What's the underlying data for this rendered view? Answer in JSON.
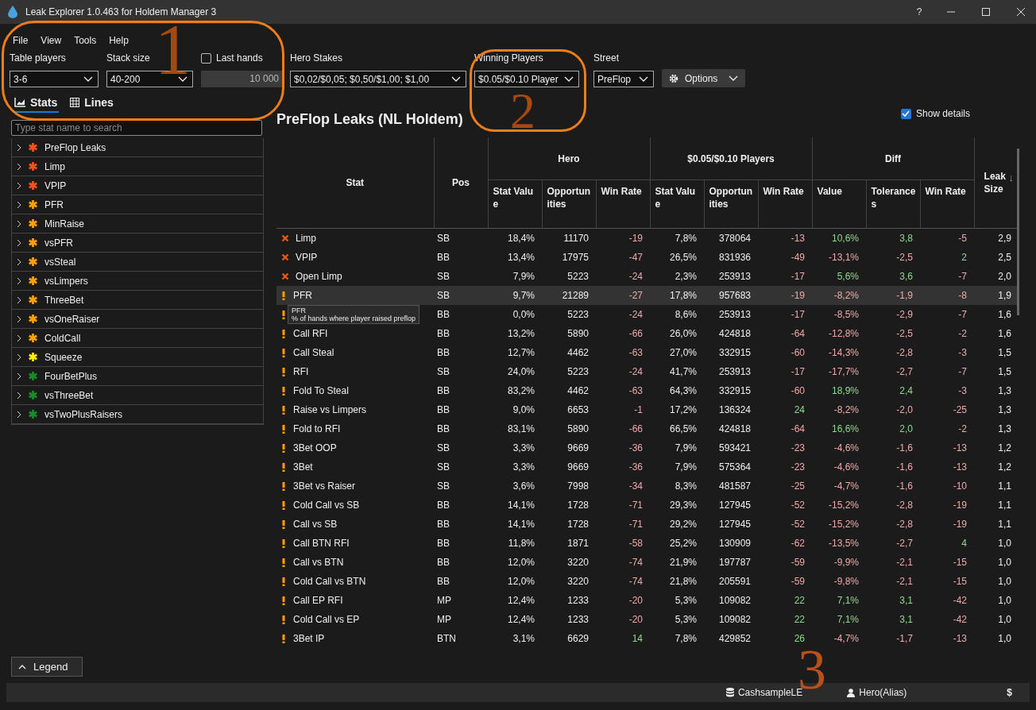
{
  "window": {
    "title": "Leak Explorer 1.0.463 for Holdem Manager 3",
    "help": "?"
  },
  "menu": [
    "File",
    "View",
    "Tools",
    "Help"
  ],
  "filters": [
    {
      "kind": "dropdown",
      "label": "Table players",
      "value": "3-6"
    },
    {
      "kind": "dropdown",
      "label": "Stack size",
      "value": "40-200"
    },
    {
      "kind": "number",
      "label": "Last hands",
      "checked": false,
      "value": "10 000"
    },
    {
      "kind": "dropdown",
      "label": "Hero Stakes",
      "value": "$0,02/$0,05; $0,50/$1,00; $1,00"
    },
    {
      "kind": "dropdown",
      "label": "Winning Players",
      "value": "$0.05/$0.10 Player"
    },
    {
      "kind": "dropdown",
      "label": "Street",
      "value": "PreFlop"
    }
  ],
  "options_button": "Options",
  "tabs": [
    {
      "label": "Stats",
      "selected": true
    },
    {
      "label": "Lines",
      "selected": false
    }
  ],
  "search": {
    "placeholder": "Type stat name to search"
  },
  "tree": [
    {
      "label": "PreFlop Leaks",
      "color": "#f4511e"
    },
    {
      "label": "Limp",
      "color": "#f4511e"
    },
    {
      "label": "VPIP",
      "color": "#f4511e"
    },
    {
      "label": "PFR",
      "color": "#ffa000"
    },
    {
      "label": "MinRaise",
      "color": "#ffa000"
    },
    {
      "label": "vsPFR",
      "color": "#ffa000"
    },
    {
      "label": "vsSteal",
      "color": "#ffa000"
    },
    {
      "label": "vsLimpers",
      "color": "#ffa000"
    },
    {
      "label": "ThreeBet",
      "color": "#ffa000"
    },
    {
      "label": "vsOneRaiser",
      "color": "#ffa000"
    },
    {
      "label": "ColdCall",
      "color": "#ffa000"
    },
    {
      "label": "Squeeze",
      "color": "#ffee00"
    },
    {
      "label": "FourBetPlus",
      "color": "#1b8a2a"
    },
    {
      "label": "vsThreeBet",
      "color": "#1b8a2a"
    },
    {
      "label": "vsTwoPlusRaisers",
      "color": "#1b8a2a"
    }
  ],
  "legend_button": "Legend",
  "report": {
    "title": "PreFlop Leaks  (NL Holdem)",
    "show_details": {
      "label": "Show details",
      "checked": true
    }
  },
  "table": {
    "stat": "Stat",
    "pos": "Pos",
    "groups": [
      {
        "label": "Hero",
        "columns": [
          "Stat Value",
          "Opportunities",
          "Win Rate"
        ]
      },
      {
        "label": "$0.05/$0.10 Players",
        "columns": [
          "Stat Value",
          "Opportunities",
          "Win Rate"
        ]
      },
      {
        "label": "Diff",
        "columns": [
          "Value",
          "Tolerances",
          "Win Rate"
        ]
      }
    ],
    "leak_size": "Leak Size",
    "sort_arrow": "↓",
    "rows": [
      {
        "kind": "error",
        "stat": "Limp",
        "pos": "SB",
        "cells": [
          "18,4%",
          "11170",
          "-19",
          "7,8%",
          "378064",
          "-13",
          "10,6%",
          "3,8",
          "-5"
        ],
        "leak_size": "2,9",
        "selected": false
      },
      {
        "kind": "error",
        "stat": "VPIP",
        "pos": "BB",
        "cells": [
          "13,4%",
          "17975",
          "-47",
          "26,5%",
          "831936",
          "-49",
          "-13,1%",
          "-2,5",
          "2"
        ],
        "leak_size": "2,5",
        "selected": false
      },
      {
        "kind": "error",
        "stat": "Open Limp",
        "pos": "SB",
        "cells": [
          "7,9%",
          "5223",
          "-24",
          "2,3%",
          "253913",
          "-17",
          "5,6%",
          "3,6",
          "-7"
        ],
        "leak_size": "2,0",
        "selected": false
      },
      {
        "kind": "warning",
        "stat": "PFR",
        "pos": "SB",
        "cells": [
          "9,7%",
          "21289",
          "-27",
          "17,8%",
          "957683",
          "-19",
          "-8,2%",
          "-1,9",
          "-8"
        ],
        "leak_size": "1,9",
        "selected": true,
        "tooltip": {
          "title": "PFR",
          "text": "% of hands where player raised preflop"
        }
      },
      {
        "kind": "warning",
        "pos": "BB",
        "cells": [
          "0,0%",
          "5223",
          "-24",
          "8,6%",
          "253913",
          "-17",
          "-8,5%",
          "-2,9",
          "-7"
        ],
        "leak_size": "1,6",
        "selected": false
      },
      {
        "kind": "warning",
        "stat": "Call RFI",
        "pos": "BB",
        "cells": [
          "13,2%",
          "5890",
          "-66",
          "26,0%",
          "424818",
          "-64",
          "-12,8%",
          "-2,5",
          "-2"
        ],
        "leak_size": "1,6",
        "selected": false
      },
      {
        "kind": "warning",
        "stat": "Call Steal",
        "pos": "BB",
        "cells": [
          "12,7%",
          "4462",
          "-63",
          "27,0%",
          "332915",
          "-60",
          "-14,3%",
          "-2,8",
          "-3"
        ],
        "leak_size": "1,5",
        "selected": false
      },
      {
        "kind": "warning",
        "stat": "RFI",
        "pos": "SB",
        "cells": [
          "24,0%",
          "5223",
          "-24",
          "41,7%",
          "253913",
          "-17",
          "-17,7%",
          "-2,7",
          "-7"
        ],
        "leak_size": "1,5",
        "selected": false
      },
      {
        "kind": "warning",
        "stat": "Fold To Steal",
        "pos": "BB",
        "cells": [
          "83,2%",
          "4462",
          "-63",
          "64,3%",
          "332915",
          "-60",
          "18,9%",
          "2,4",
          "-3"
        ],
        "leak_size": "1,3",
        "selected": false
      },
      {
        "kind": "warning",
        "stat": "Raise vs Limpers",
        "pos": "BB",
        "cells": [
          "9,0%",
          "6653",
          "-1",
          "17,2%",
          "136324",
          "24",
          "-8,2%",
          "-2,0",
          "-25"
        ],
        "leak_size": "1,3",
        "selected": false
      },
      {
        "kind": "warning",
        "stat": "Fold to RFI",
        "pos": "BB",
        "cells": [
          "83,1%",
          "5890",
          "-66",
          "66,5%",
          "424818",
          "-64",
          "16,6%",
          "2,0",
          "-2"
        ],
        "leak_size": "1,3",
        "selected": false
      },
      {
        "kind": "warning",
        "stat": "3Bet OOP",
        "pos": "SB",
        "cells": [
          "3,3%",
          "9669",
          "-36",
          "7,9%",
          "593421",
          "-23",
          "-4,6%",
          "-1,6",
          "-13"
        ],
        "leak_size": "1,2",
        "selected": false
      },
      {
        "kind": "warning",
        "stat": "3Bet",
        "pos": "SB",
        "cells": [
          "3,3%",
          "9669",
          "-36",
          "7,9%",
          "575364",
          "-23",
          "-4,6%",
          "-1,6",
          "-13"
        ],
        "leak_size": "1,2",
        "selected": false
      },
      {
        "kind": "warning",
        "stat": "3Bet vs Raiser",
        "pos": "SB",
        "cells": [
          "3,6%",
          "7998",
          "-34",
          "8,3%",
          "481587",
          "-25",
          "-4,7%",
          "-1,6",
          "-10"
        ],
        "leak_size": "1,1",
        "selected": false
      },
      {
        "kind": "warning",
        "stat": "Cold Call vs SB",
        "pos": "BB",
        "cells": [
          "14,1%",
          "1728",
          "-71",
          "29,3%",
          "127945",
          "-52",
          "-15,2%",
          "-2,8",
          "-19"
        ],
        "leak_size": "1,1",
        "selected": false
      },
      {
        "kind": "warning",
        "stat": "Call vs SB",
        "pos": "BB",
        "cells": [
          "14,1%",
          "1728",
          "-71",
          "29,2%",
          "127945",
          "-52",
          "-15,2%",
          "-2,8",
          "-19"
        ],
        "leak_size": "1,1",
        "selected": false
      },
      {
        "kind": "warning",
        "stat": "Call BTN RFI",
        "pos": "BB",
        "cells": [
          "11,8%",
          "1871",
          "-58",
          "25,2%",
          "130909",
          "-62",
          "-13,5%",
          "-2,7",
          "4"
        ],
        "leak_size": "1,0",
        "selected": false
      },
      {
        "kind": "warning",
        "stat": "Call vs BTN",
        "pos": "BB",
        "cells": [
          "12,0%",
          "3220",
          "-74",
          "21,9%",
          "197787",
          "-59",
          "-9,9%",
          "-2,1",
          "-15"
        ],
        "leak_size": "1,0",
        "selected": false
      },
      {
        "kind": "warning",
        "stat": "Cold Call vs BTN",
        "pos": "BB",
        "cells": [
          "12,0%",
          "3220",
          "-74",
          "21,8%",
          "205591",
          "-59",
          "-9,8%",
          "-2,1",
          "-15"
        ],
        "leak_size": "1,0",
        "selected": false
      },
      {
        "kind": "warning",
        "stat": "Call EP RFI",
        "pos": "MP",
        "cells": [
          "12,4%",
          "1233",
          "-20",
          "5,3%",
          "109082",
          "22",
          "7,1%",
          "3,1",
          "-42"
        ],
        "leak_size": "1,0",
        "selected": false
      },
      {
        "kind": "warning",
        "stat": "Cold Call vs EP",
        "pos": "MP",
        "cells": [
          "12,4%",
          "1233",
          "-20",
          "5,3%",
          "109082",
          "22",
          "7,1%",
          "3,1",
          "-42"
        ],
        "leak_size": "1,0",
        "selected": false
      },
      {
        "kind": "warning",
        "stat": "3Bet IP",
        "pos": "BTN",
        "cells": [
          "3,1%",
          "6629",
          "14",
          "7,8%",
          "429852",
          "26",
          "-4,7%",
          "-1,7",
          "-13"
        ],
        "leak_size": "1,0",
        "selected": false
      }
    ]
  },
  "status_bar": {
    "database": "CashsampleLE",
    "player": "Hero(Alias)",
    "currency": "$"
  },
  "annotations": [
    {
      "label": "1",
      "circled": true
    },
    {
      "label": "2",
      "circled": true
    },
    {
      "label": "3",
      "circled": false
    }
  ]
}
